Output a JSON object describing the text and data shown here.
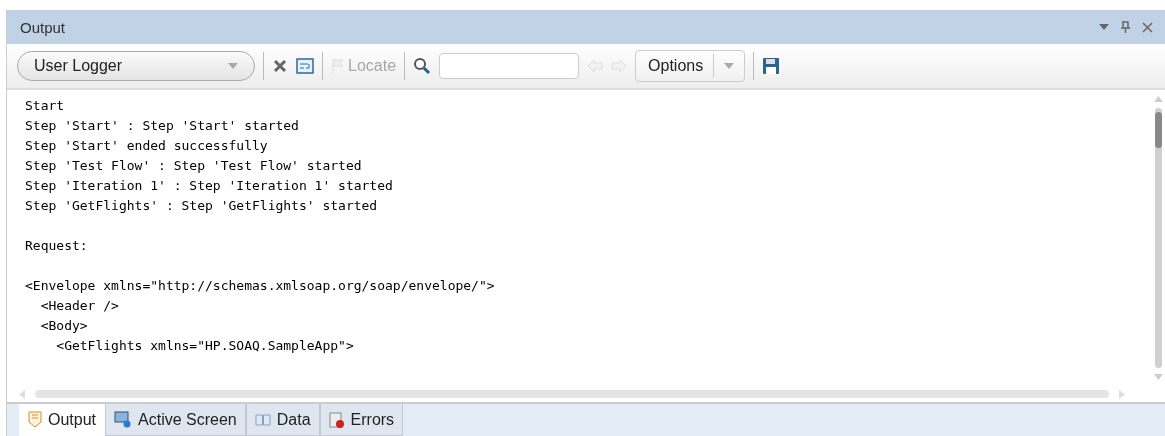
{
  "panel": {
    "title": "Output"
  },
  "toolbar": {
    "logger": "User Logger",
    "locate": {
      "label": "Locate",
      "disabled": true
    },
    "prev_disabled": true,
    "next_disabled": true,
    "options": "Options"
  },
  "log_groups": [
    [
      "Start",
      "Step 'Start' : Step 'Start' started",
      "Step 'Start' ended successfully",
      "Step 'Test Flow' : Step 'Test Flow' started",
      "Step 'Iteration 1' : Step 'Iteration 1' started",
      "Step 'GetFlights' : Step 'GetFlights' started"
    ],
    [
      "Request:"
    ],
    [
      "<Envelope xmlns=\"http://schemas.xmlsoap.org/soap/envelope/\">",
      "  <Header />",
      "  <Body>",
      "    <GetFlights xmlns=\"HP.SOAQ.SampleApp\">"
    ]
  ],
  "tabs": [
    {
      "label": "Output",
      "selected": true,
      "kind": "output"
    },
    {
      "label": "Active Screen",
      "selected": false,
      "kind": "screen"
    },
    {
      "label": "Data",
      "selected": false,
      "kind": "data"
    },
    {
      "label": "Errors",
      "selected": false,
      "kind": "errors"
    }
  ]
}
